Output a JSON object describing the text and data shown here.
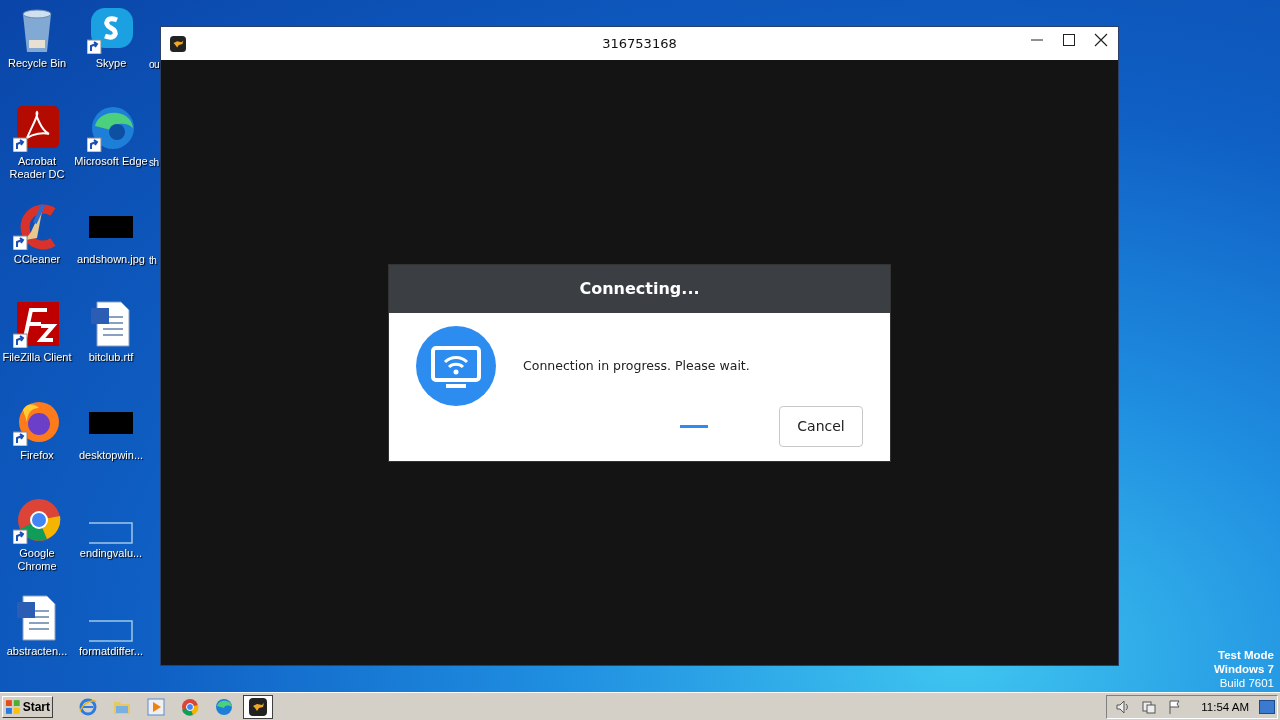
{
  "desktop": {
    "icons": [
      {
        "label": "Recycle Bin",
        "kind": "trash"
      },
      {
        "label": "Acrobat Reader DC",
        "kind": "pdf"
      },
      {
        "label": "CCleaner",
        "kind": "broom"
      },
      {
        "label": "FileZilla Client",
        "kind": "ftp"
      },
      {
        "label": "Firefox",
        "kind": "fox"
      },
      {
        "label": "Google Chrome",
        "kind": "browser"
      },
      {
        "label": "abstracten...",
        "kind": "document"
      },
      {
        "label": "Skype",
        "kind": "chat"
      },
      {
        "label": "Microsoft Edge",
        "kind": "swirl"
      },
      {
        "label": "andshown.jpg",
        "kind": "image"
      },
      {
        "label": "bitclub.rtf",
        "kind": "document"
      },
      {
        "label": "desktopwin...",
        "kind": "image"
      },
      {
        "label": "endingvalu...",
        "kind": "blank"
      },
      {
        "label": "formatdiffer...",
        "kind": "blank"
      },
      {
        "label": "ou",
        "kind": "clipped"
      },
      {
        "label": "sh",
        "kind": "clipped"
      },
      {
        "label": "th",
        "kind": "clipped"
      }
    ],
    "os_notice": [
      "Test Mode",
      "Windows 7",
      "Build 7601"
    ]
  },
  "window": {
    "title": "316753168",
    "dialog": {
      "title": "Connecting...",
      "message": "Connection in progress. Please wait.",
      "cancel_button": "Cancel"
    }
  },
  "taskbar": {
    "start": "Start",
    "apps": [
      {
        "kind": "ie",
        "selected": false
      },
      {
        "kind": "folder",
        "selected": false
      },
      {
        "kind": "media",
        "selected": false
      },
      {
        "kind": "browser",
        "selected": false
      },
      {
        "kind": "swirl",
        "selected": false
      },
      {
        "kind": "kangaroo",
        "selected": true
      }
    ],
    "clock": "11:54 AM"
  }
}
